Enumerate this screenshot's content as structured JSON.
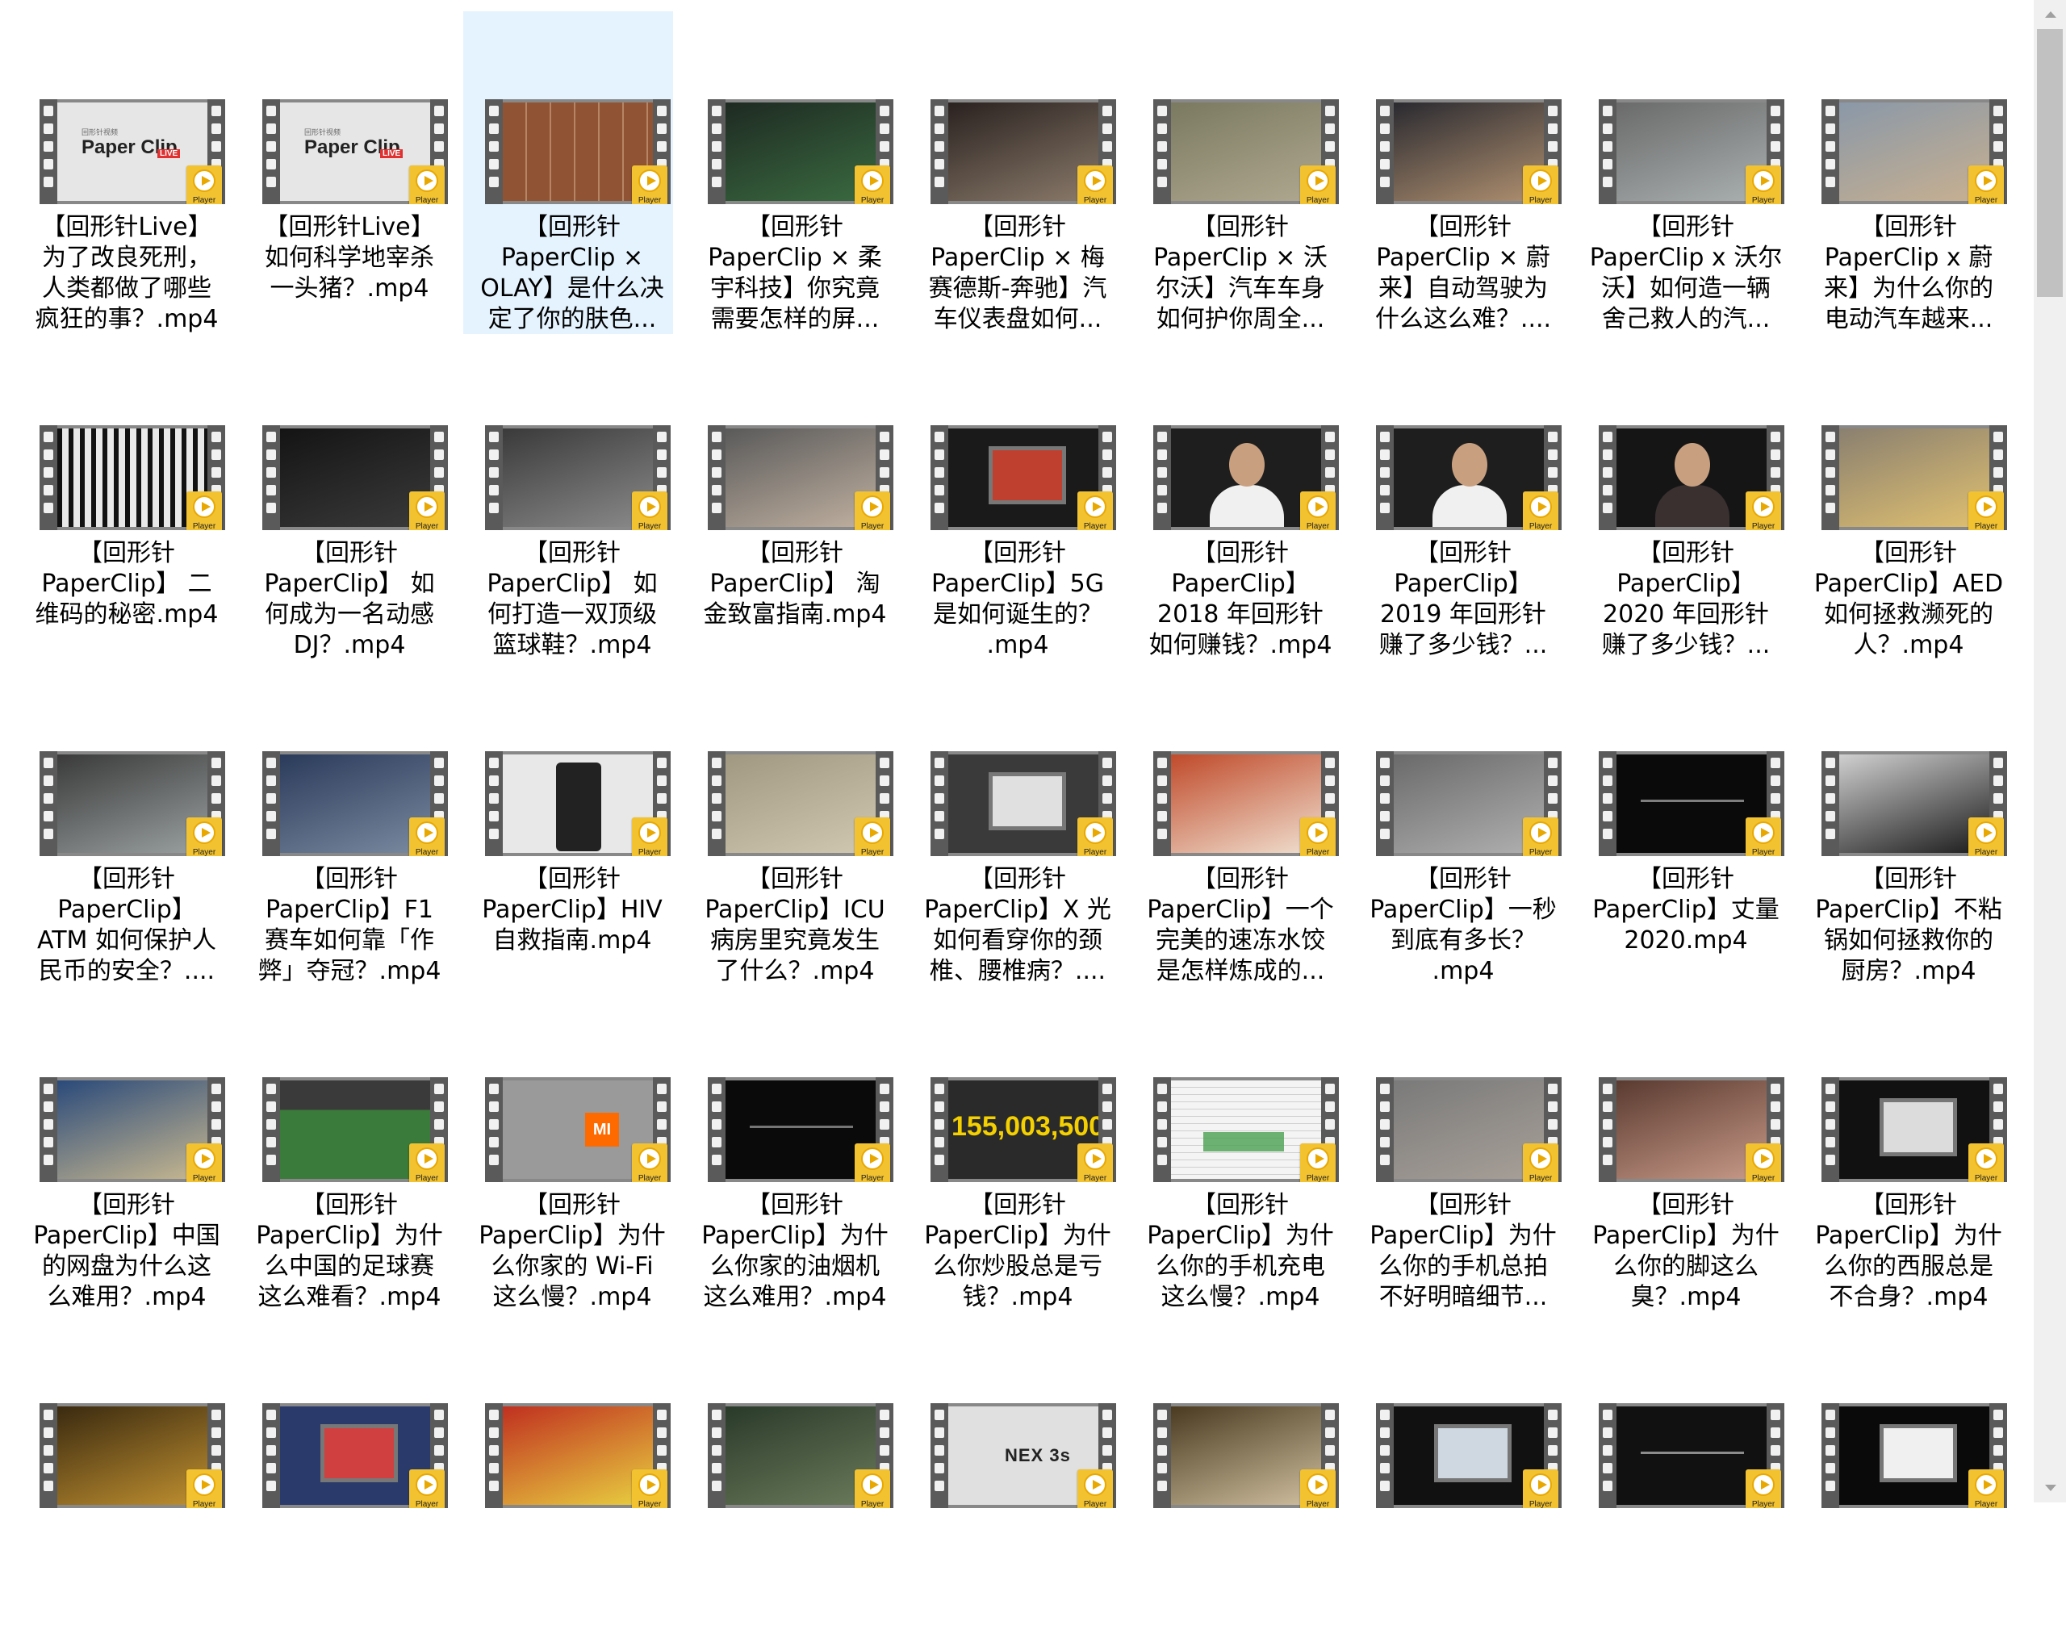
{
  "badge_label": "Player",
  "thumbnail_text": {
    "brand_small": "回形针视频",
    "brand": "Paper Clip",
    "live": "LIVE",
    "mi": "MI",
    "amount": "155,003,500",
    "nex": "NEX 3s"
  },
  "files": [
    {
      "name": "【回形针Live】为了改良死刑，人类都做了哪些疯狂的事？.mp4",
      "lines": [
        "【回形针Live】",
        "为了改良死刑，",
        "人类都做了哪些",
        "疯狂的事？.mp4"
      ],
      "selected": false,
      "thumb": "papercliplive",
      "colors": [
        "#e6e6e6",
        "#cfcfcf"
      ]
    },
    {
      "name": "【回形针Live】如何科学地宰杀一头猪？.mp4",
      "lines": [
        "【回形针Live】",
        "如何科学地宰杀",
        "一头猪？.mp4"
      ],
      "selected": false,
      "thumb": "papercliplive",
      "colors": [
        "#e6e6e6",
        "#cfcfcf"
      ]
    },
    {
      "name": "【回形针PaperClip × OLAY】是什么决定了你的肤色….mp4",
      "lines": [
        "【回形针",
        "PaperClip ×",
        "OLAY】是什么决",
        "定了你的肤色..."
      ],
      "selected": true,
      "thumb": "swatches",
      "colors": [
        "#c89a7a",
        "#8a5a40"
      ]
    },
    {
      "name": "【回形针PaperClip × 柔宇科技】你究竟需要怎样的屏….mp4",
      "lines": [
        "【回形针",
        "PaperClip × 柔",
        "宇科技】你究竟",
        "需要怎样的屏..."
      ],
      "selected": false,
      "thumb": "scene",
      "colors": [
        "#1e2a22",
        "#3a6a40"
      ]
    },
    {
      "name": "【回形针PaperClip × 梅赛德斯-奔驰】汽车仪表盘如何….mp4",
      "lines": [
        "【回形针",
        "PaperClip × 梅",
        "赛德斯-奔驰】汽",
        "车仪表盘如何..."
      ],
      "selected": false,
      "thumb": "scene",
      "colors": [
        "#2a2220",
        "#8a7a6a"
      ]
    },
    {
      "name": "【回形针PaperClip × 沃尔沃】汽车车身如何护你周全….mp4",
      "lines": [
        "【回形针",
        "PaperClip × 沃",
        "尔沃】汽车车身",
        "如何护你周全..."
      ],
      "selected": false,
      "thumb": "scene",
      "colors": [
        "#7a7a60",
        "#b0a890"
      ]
    },
    {
      "name": "【回形针PaperClip × 蔚来】自动驾驶为什么这么难？….mp4",
      "lines": [
        "【回形针",
        "PaperClip × 蔚",
        "来】自动驾驶为",
        "什么这么难？...."
      ],
      "selected": false,
      "thumb": "scene",
      "colors": [
        "#2a2a30",
        "#b09070"
      ]
    },
    {
      "name": "【回形针PaperClip x 沃尔沃】如何造一辆舍己救人的汽….mp4",
      "lines": [
        "【回形针",
        "PaperClip x 沃尔",
        "沃】如何造一辆",
        "舍己救人的汽..."
      ],
      "selected": false,
      "thumb": "scene",
      "colors": [
        "#6a6a6a",
        "#aab0b0"
      ]
    },
    {
      "name": "【回形针PaperClip x 蔚来】为什么你的电动汽车越来….mp4",
      "lines": [
        "【回形针",
        "PaperClip x 蔚",
        "来】为什么你的",
        "电动汽车越来..."
      ],
      "selected": false,
      "thumb": "scene",
      "colors": [
        "#8a98a8",
        "#c8b090"
      ]
    },
    {
      "name": "【回形针PaperClip】二维码的秘密.mp4",
      "lines": [
        "【回形针",
        "PaperClip】 二",
        "维码的秘密.mp4"
      ],
      "selected": false,
      "thumb": "qr",
      "colors": [
        "#e8e8e8",
        "#111111"
      ]
    },
    {
      "name": "【回形针PaperClip】如何成为一名动感DJ？.mp4",
      "lines": [
        "【回形针",
        "PaperClip】 如",
        "何成为一名动感",
        "DJ？.mp4"
      ],
      "selected": false,
      "thumb": "scene",
      "colors": [
        "#141414",
        "#3a3a3a"
      ]
    },
    {
      "name": "【回形针PaperClip】如何打造一双顶级篮球鞋？.mp4",
      "lines": [
        "【回形针",
        "PaperClip】 如",
        "何打造一双顶级",
        "篮球鞋？.mp4"
      ],
      "selected": false,
      "thumb": "scene",
      "colors": [
        "#3a3a3a",
        "#8a8a8a"
      ]
    },
    {
      "name": "【回形针PaperClip】淘金致富指南.mp4",
      "lines": [
        "【回形针",
        "PaperClip】 淘",
        "金致富指南.mp4"
      ],
      "selected": false,
      "thumb": "scene",
      "colors": [
        "#5a5a5a",
        "#c0b0a0"
      ]
    },
    {
      "name": "【回形针PaperClip】5G是如何诞生的？.mp4",
      "lines": [
        "【回形针",
        "PaperClip】5G",
        "是如何诞生的？",
        ".mp4"
      ],
      "selected": false,
      "thumb": "tv",
      "colors": [
        "#1a1a1a",
        "#c04030"
      ]
    },
    {
      "name": "【回形针PaperClip】2018 年回形针如何赚钱？.mp4",
      "lines": [
        "【回形针",
        "PaperClip】",
        "2018 年回形针",
        "如何赚钱？.mp4"
      ],
      "selected": false,
      "thumb": "person",
      "colors": [
        "#1e1e1e",
        "#f0f0f0"
      ]
    },
    {
      "name": "【回形针PaperClip】2019 年回形针赚了多少钱？….mp4",
      "lines": [
        "【回形针",
        "PaperClip】",
        "2019 年回形针",
        "赚了多少钱？..."
      ],
      "selected": false,
      "thumb": "person",
      "colors": [
        "#1e1e1e",
        "#f0f0f0"
      ]
    },
    {
      "name": "【回形针PaperClip】2020 年回形针赚了多少钱？….mp4",
      "lines": [
        "【回形针",
        "PaperClip】",
        "2020 年回形针",
        "赚了多少钱？..."
      ],
      "selected": false,
      "thumb": "person",
      "colors": [
        "#151515",
        "#3a3030"
      ]
    },
    {
      "name": "【回形针PaperClip】AED如何拯救濒死的人？.mp4",
      "lines": [
        "【回形针",
        "PaperClip】AED",
        "如何拯救濒死的",
        "人？.mp4"
      ],
      "selected": false,
      "thumb": "scene",
      "colors": [
        "#8a8070",
        "#e0c070"
      ]
    },
    {
      "name": "【回形针PaperClip】ATM 如何保护人民币的安全？….mp4",
      "lines": [
        "【回形针",
        "PaperClip】",
        "ATM 如何保护人",
        "民币的安全？...."
      ],
      "selected": false,
      "thumb": "scene",
      "colors": [
        "#3a3a3a",
        "#9aa0a0"
      ]
    },
    {
      "name": "【回形针PaperClip】F1赛车如何靠「作弊」夺冠？.mp4",
      "lines": [
        "【回形针",
        "PaperClip】F1",
        "赛车如何靠「作",
        "弊」夺冠？.mp4"
      ],
      "selected": false,
      "thumb": "scene",
      "colors": [
        "#2a3a5a",
        "#7a8aa0"
      ]
    },
    {
      "name": "【回形针PaperClip】HIV自救指南.mp4",
      "lines": [
        "【回形针",
        "PaperClip】HIV",
        "自救指南.mp4"
      ],
      "selected": false,
      "thumb": "phone",
      "colors": [
        "#e8e8e8",
        "#222222"
      ]
    },
    {
      "name": "【回形针PaperClip】ICU病房里究竟发生了什么？.mp4",
      "lines": [
        "【回形针",
        "PaperClip】ICU",
        "病房里究竟发生",
        "了什么？.mp4"
      ],
      "selected": false,
      "thumb": "scene",
      "colors": [
        "#a09880",
        "#d0c8b0"
      ]
    },
    {
      "name": "【回形针PaperClip】X 光如何看穿你的颈椎、腰椎病？….mp4",
      "lines": [
        "【回形针",
        "PaperClip】X 光",
        "如何看穿你的颈",
        "椎、腰椎病？...."
      ],
      "selected": false,
      "thumb": "tv",
      "colors": [
        "#3a3a3a",
        "#e0e0e0"
      ]
    },
    {
      "name": "【回形针PaperClip】一个完美的速冻水饺是怎样炼成的….mp4",
      "lines": [
        "【回形针",
        "PaperClip】一个",
        "完美的速冻水饺",
        "是怎样炼成的..."
      ],
      "selected": false,
      "thumb": "scene",
      "colors": [
        "#c04a2a",
        "#f0e0d0"
      ]
    },
    {
      "name": "【回形针PaperClip】一秒到底有多长？.mp4",
      "lines": [
        "【回形针",
        "PaperClip】一秒",
        "到底有多长？",
        ".mp4"
      ],
      "selected": false,
      "thumb": "scene",
      "colors": [
        "#6a6a6a",
        "#b0b0b0"
      ]
    },
    {
      "name": "【回形针PaperClip】丈量2020.mp4",
      "lines": [
        "【回形针",
        "PaperClip】丈量",
        "2020.mp4"
      ],
      "selected": false,
      "thumb": "dark",
      "colors": [
        "#0a0a0a",
        "#cccccc"
      ]
    },
    {
      "name": "【回形针PaperClip】不粘锅如何拯救你的厨房？.mp4",
      "lines": [
        "【回形针",
        "PaperClip】不粘",
        "锅如何拯救你的",
        "厨房？.mp4"
      ],
      "selected": false,
      "thumb": "scene",
      "colors": [
        "#d0d0d0",
        "#1a1a1a"
      ]
    },
    {
      "name": "【回形针PaperClip】中国的网盘为什么这么难用？.mp4",
      "lines": [
        "【回形针",
        "PaperClip】中国",
        "的网盘为什么这",
        "么难用？.mp4"
      ],
      "selected": false,
      "thumb": "scene",
      "colors": [
        "#2a4a7a",
        "#c8b890"
      ]
    },
    {
      "name": "【回形针PaperClip】为什么中国的足球赛这么难看？.mp4",
      "lines": [
        "【回形针",
        "PaperClip】为什",
        "么中国的足球赛",
        "这么难看？.mp4"
      ],
      "selected": false,
      "thumb": "field",
      "colors": [
        "#3a7a3a",
        "#5a9a4a"
      ]
    },
    {
      "name": "【回形针PaperClip】为什么你家的 Wi-Fi 这么慢？.mp4",
      "lines": [
        "【回形针",
        "PaperClip】为什",
        "么你家的 Wi-Fi",
        "这么慢？.mp4"
      ],
      "selected": false,
      "thumb": "mi",
      "colors": [
        "#6a6a6a",
        "#9a9a9a"
      ]
    },
    {
      "name": "【回形针PaperClip】为什么你家的油烟机这么难用？.mp4",
      "lines": [
        "【回形针",
        "PaperClip】为什",
        "么你家的油烟机",
        "这么难用？.mp4"
      ],
      "selected": false,
      "thumb": "dark",
      "colors": [
        "#0a0a0a",
        "#bbbbbb"
      ]
    },
    {
      "name": "【回形针PaperClip】为什么你炒股总是亏钱？.mp4",
      "lines": [
        "【回形针",
        "PaperClip】为什",
        "么你炒股总是亏",
        "钱？.mp4"
      ],
      "selected": false,
      "thumb": "stock",
      "colors": [
        "#2a2a2a",
        "#d04a3a"
      ]
    },
    {
      "name": "【回形针PaperClip】为什么你的手机充电这么慢？.mp4",
      "lines": [
        "【回形针",
        "PaperClip】为什",
        "么你的手机充电",
        "这么慢？.mp4"
      ],
      "selected": false,
      "thumb": "doc",
      "colors": [
        "#f4f4f4",
        "#4aa050"
      ]
    },
    {
      "name": "【回形针PaperClip】为什么你的手机总拍不好明暗细节….mp4",
      "lines": [
        "【回形针",
        "PaperClip】为什",
        "么你的手机总拍",
        "不好明暗细节..."
      ],
      "selected": false,
      "thumb": "scene",
      "colors": [
        "#7a7a7a",
        "#a8a098"
      ]
    },
    {
      "name": "【回形针PaperClip】为什么你的脚这么臭？.mp4",
      "lines": [
        "【回形针",
        "PaperClip】为什",
        "么你的脚这么",
        "臭？.mp4"
      ],
      "selected": false,
      "thumb": "scene",
      "colors": [
        "#5a3a30",
        "#c89a88"
      ]
    },
    {
      "name": "【回形针PaperClip】为什么你的西服总是不合身？.mp4",
      "lines": [
        "【回形针",
        "PaperClip】为什",
        "么你的西服总是",
        "不合身？.mp4"
      ],
      "selected": false,
      "thumb": "tv",
      "colors": [
        "#111111",
        "#dcdcdc"
      ]
    },
    {
      "name": "",
      "lines": [],
      "selected": false,
      "thumb": "scene",
      "colors": [
        "#3a2a10",
        "#c09030"
      ]
    },
    {
      "name": "",
      "lines": [],
      "selected": false,
      "thumb": "tv",
      "colors": [
        "#2a3a6a",
        "#d04040"
      ]
    },
    {
      "name": "",
      "lines": [],
      "selected": false,
      "thumb": "scene",
      "colors": [
        "#c03020",
        "#e8d040"
      ]
    },
    {
      "name": "",
      "lines": [],
      "selected": false,
      "thumb": "scene",
      "colors": [
        "#2a3a2a",
        "#6a7a5a"
      ]
    },
    {
      "name": "",
      "lines": [],
      "selected": false,
      "thumb": "nex",
      "colors": [
        "#e0e0e0",
        "#bdbdbd"
      ]
    },
    {
      "name": "",
      "lines": [],
      "selected": false,
      "thumb": "scene",
      "colors": [
        "#4a3a20",
        "#d0c0a0"
      ]
    },
    {
      "name": "",
      "lines": [],
      "selected": false,
      "thumb": "tv",
      "colors": [
        "#111111",
        "#cfd8e0"
      ]
    },
    {
      "name": "",
      "lines": [],
      "selected": false,
      "thumb": "dark",
      "colors": [
        "#111111",
        "#e0e0e0"
      ]
    },
    {
      "name": "",
      "lines": [],
      "selected": false,
      "thumb": "tv",
      "colors": [
        "#0a0a0a",
        "#f0f0f0"
      ]
    }
  ]
}
